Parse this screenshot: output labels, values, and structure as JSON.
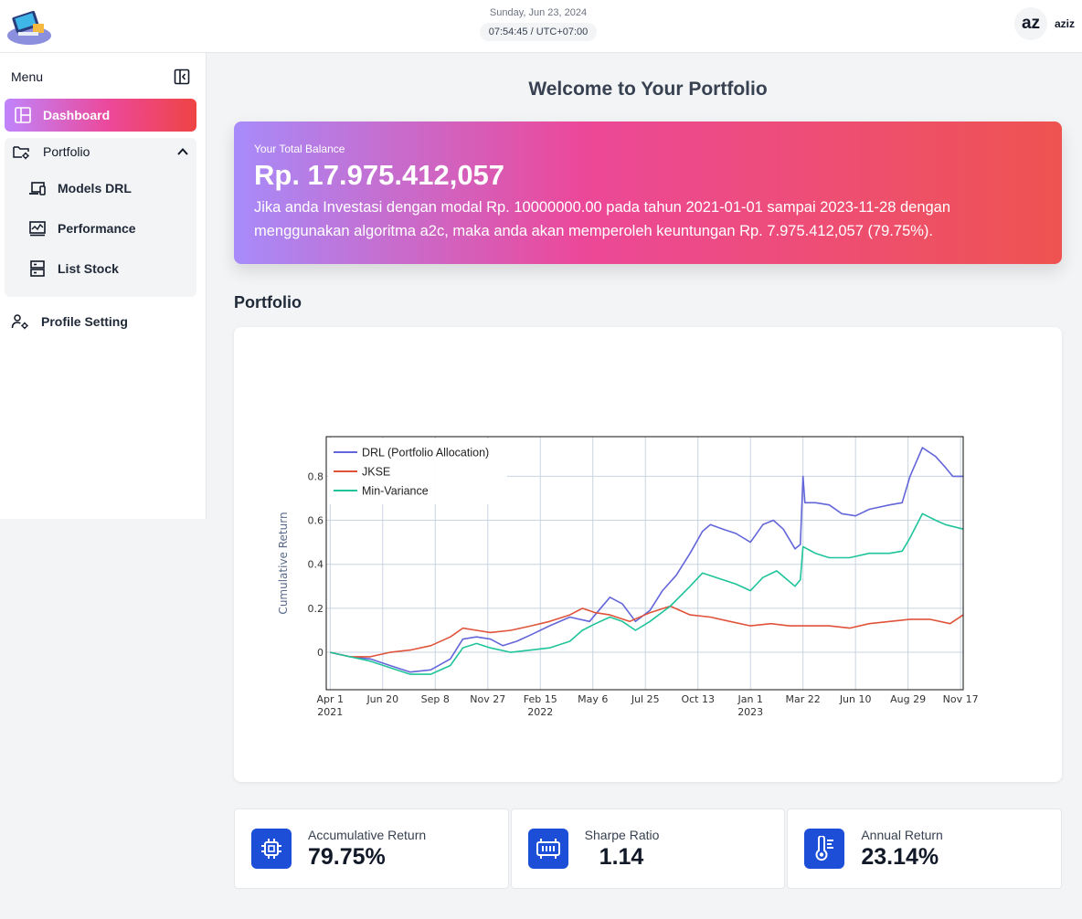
{
  "header": {
    "date": "Sunday, Jun 23, 2024",
    "time": "07:54:45 / UTC+07:00",
    "avatar_initials": "az",
    "username": "aziz"
  },
  "sidebar": {
    "menu_label": "Menu",
    "dashboard_label": "Dashboard",
    "portfolio_label": "Portfolio",
    "sub_items": [
      "Models DRL",
      "Performance",
      "List Stock"
    ],
    "profile_label": "Profile Setting"
  },
  "main": {
    "welcome": "Welcome to Your Portfolio",
    "balance_label": "Your Total Balance",
    "balance_amount": "Rp. 17.975.412,057",
    "balance_desc": "Jika anda Investasi dengan modal Rp. 10000000.00 pada tahun 2021-01-01 sampai 2023-11-28 dengan menggunakan algoritma a2c, maka anda akan memperoleh keuntungan Rp. 7.975.412,057 (79.75%).",
    "section_title": "Portfolio"
  },
  "stats": [
    {
      "name": "Accumulative Return",
      "value": "79.75%"
    },
    {
      "name": "Sharpe Ratio",
      "value": "1.14"
    },
    {
      "name": "Annual Return",
      "value": "23.14%"
    }
  ],
  "colors": {
    "drl": "#6366d9",
    "jkse": "#e0533a",
    "minvar": "#1fc49a",
    "accent_blue": "#1d4ed8"
  },
  "chart_data": {
    "type": "line",
    "ylabel": "Cumulative Return",
    "ylim": [
      -0.17,
      0.98
    ],
    "y_ticks": [
      "0",
      "0.2",
      "0.4",
      "0.6",
      "0.8"
    ],
    "x_ticks": [
      {
        "date": "2021-04-01",
        "label": "Apr 1",
        "sub": "2021"
      },
      {
        "date": "2021-06-20",
        "label": "Jun 20",
        "sub": ""
      },
      {
        "date": "2021-09-08",
        "label": "Sep 8",
        "sub": ""
      },
      {
        "date": "2021-11-27",
        "label": "Nov 27",
        "sub": ""
      },
      {
        "date": "2022-02-15",
        "label": "Feb 15",
        "sub": "2022"
      },
      {
        "date": "2022-05-06",
        "label": "May 6",
        "sub": ""
      },
      {
        "date": "2022-07-25",
        "label": "Jul 25",
        "sub": ""
      },
      {
        "date": "2022-10-13",
        "label": "Oct 13",
        "sub": ""
      },
      {
        "date": "2023-01-01",
        "label": "Jan 1",
        "sub": "2023"
      },
      {
        "date": "2023-03-22",
        "label": "Mar 22",
        "sub": ""
      },
      {
        "date": "2023-06-10",
        "label": "Jun 10",
        "sub": ""
      },
      {
        "date": "2023-08-29",
        "label": "Aug 29",
        "sub": ""
      },
      {
        "date": "2023-11-17",
        "label": "Nov 17",
        "sub": ""
      }
    ],
    "xlim": [
      "2021-03-26",
      "2023-11-21"
    ],
    "legend_position": "top-left",
    "series": [
      {
        "name": "DRL (Portfolio Allocation)",
        "color": "#6366d9",
        "points": [
          [
            "2021-04-01",
            0.0
          ],
          [
            "2021-05-01",
            -0.02
          ],
          [
            "2021-06-01",
            -0.03
          ],
          [
            "2021-07-01",
            -0.06
          ],
          [
            "2021-08-01",
            -0.09
          ],
          [
            "2021-09-01",
            -0.08
          ],
          [
            "2021-10-01",
            -0.03
          ],
          [
            "2021-10-20",
            0.06
          ],
          [
            "2021-11-10",
            0.07
          ],
          [
            "2021-12-01",
            0.06
          ],
          [
            "2021-12-20",
            0.03
          ],
          [
            "2022-01-10",
            0.05
          ],
          [
            "2022-02-01",
            0.08
          ],
          [
            "2022-03-01",
            0.12
          ],
          [
            "2022-04-01",
            0.16
          ],
          [
            "2022-05-01",
            0.14
          ],
          [
            "2022-06-01",
            0.25
          ],
          [
            "2022-06-20",
            0.22
          ],
          [
            "2022-07-10",
            0.14
          ],
          [
            "2022-08-01",
            0.19
          ],
          [
            "2022-08-20",
            0.28
          ],
          [
            "2022-09-10",
            0.35
          ],
          [
            "2022-10-01",
            0.45
          ],
          [
            "2022-10-20",
            0.55
          ],
          [
            "2022-11-01",
            0.58
          ],
          [
            "2022-11-20",
            0.56
          ],
          [
            "2022-12-10",
            0.54
          ],
          [
            "2023-01-01",
            0.5
          ],
          [
            "2023-01-20",
            0.58
          ],
          [
            "2023-02-05",
            0.6
          ],
          [
            "2023-02-20",
            0.56
          ],
          [
            "2023-03-10",
            0.47
          ],
          [
            "2023-03-18",
            0.49
          ],
          [
            "2023-03-22",
            0.8
          ],
          [
            "2023-03-25",
            0.68
          ],
          [
            "2023-04-10",
            0.68
          ],
          [
            "2023-05-01",
            0.67
          ],
          [
            "2023-05-20",
            0.63
          ],
          [
            "2023-06-10",
            0.62
          ],
          [
            "2023-07-01",
            0.65
          ],
          [
            "2023-08-01",
            0.67
          ],
          [
            "2023-08-20",
            0.68
          ],
          [
            "2023-09-01",
            0.8
          ],
          [
            "2023-09-20",
            0.93
          ],
          [
            "2023-10-10",
            0.89
          ],
          [
            "2023-10-25",
            0.84
          ],
          [
            "2023-11-05",
            0.8
          ],
          [
            "2023-11-21",
            0.8
          ]
        ]
      },
      {
        "name": "JKSE",
        "color": "#e0533a",
        "points": [
          [
            "2021-04-01",
            0.0
          ],
          [
            "2021-05-01",
            -0.02
          ],
          [
            "2021-06-01",
            -0.02
          ],
          [
            "2021-07-01",
            0.0
          ],
          [
            "2021-08-01",
            0.01
          ],
          [
            "2021-09-01",
            0.03
          ],
          [
            "2021-10-01",
            0.07
          ],
          [
            "2021-10-20",
            0.11
          ],
          [
            "2021-11-10",
            0.1
          ],
          [
            "2021-12-01",
            0.09
          ],
          [
            "2022-01-01",
            0.1
          ],
          [
            "2022-02-01",
            0.12
          ],
          [
            "2022-03-01",
            0.14
          ],
          [
            "2022-04-01",
            0.17
          ],
          [
            "2022-04-20",
            0.2
          ],
          [
            "2022-05-10",
            0.18
          ],
          [
            "2022-06-01",
            0.17
          ],
          [
            "2022-07-01",
            0.14
          ],
          [
            "2022-08-01",
            0.18
          ],
          [
            "2022-09-01",
            0.21
          ],
          [
            "2022-10-01",
            0.17
          ],
          [
            "2022-11-01",
            0.16
          ],
          [
            "2022-12-01",
            0.14
          ],
          [
            "2023-01-01",
            0.12
          ],
          [
            "2023-02-01",
            0.13
          ],
          [
            "2023-03-01",
            0.12
          ],
          [
            "2023-04-01",
            0.12
          ],
          [
            "2023-05-01",
            0.12
          ],
          [
            "2023-06-01",
            0.11
          ],
          [
            "2023-07-01",
            0.13
          ],
          [
            "2023-08-01",
            0.14
          ],
          [
            "2023-09-01",
            0.15
          ],
          [
            "2023-10-01",
            0.15
          ],
          [
            "2023-11-01",
            0.13
          ],
          [
            "2023-11-21",
            0.17
          ]
        ]
      },
      {
        "name": "Min-Variance",
        "color": "#1fc49a",
        "points": [
          [
            "2021-04-01",
            0.0
          ],
          [
            "2021-05-01",
            -0.02
          ],
          [
            "2021-06-01",
            -0.04
          ],
          [
            "2021-07-01",
            -0.07
          ],
          [
            "2021-08-01",
            -0.1
          ],
          [
            "2021-09-01",
            -0.1
          ],
          [
            "2021-10-01",
            -0.06
          ],
          [
            "2021-10-20",
            0.02
          ],
          [
            "2021-11-10",
            0.04
          ],
          [
            "2021-12-01",
            0.02
          ],
          [
            "2022-01-01",
            0.0
          ],
          [
            "2022-02-01",
            0.01
          ],
          [
            "2022-03-01",
            0.02
          ],
          [
            "2022-04-01",
            0.05
          ],
          [
            "2022-04-20",
            0.1
          ],
          [
            "2022-05-10",
            0.13
          ],
          [
            "2022-06-01",
            0.16
          ],
          [
            "2022-06-20",
            0.14
          ],
          [
            "2022-07-10",
            0.1
          ],
          [
            "2022-08-01",
            0.14
          ],
          [
            "2022-09-01",
            0.21
          ],
          [
            "2022-10-01",
            0.3
          ],
          [
            "2022-10-20",
            0.36
          ],
          [
            "2022-11-20",
            0.33
          ],
          [
            "2022-12-10",
            0.31
          ],
          [
            "2023-01-01",
            0.28
          ],
          [
            "2023-01-20",
            0.34
          ],
          [
            "2023-02-10",
            0.37
          ],
          [
            "2023-03-10",
            0.3
          ],
          [
            "2023-03-18",
            0.33
          ],
          [
            "2023-03-22",
            0.48
          ],
          [
            "2023-04-10",
            0.45
          ],
          [
            "2023-05-01",
            0.43
          ],
          [
            "2023-06-01",
            0.43
          ],
          [
            "2023-07-01",
            0.45
          ],
          [
            "2023-08-01",
            0.45
          ],
          [
            "2023-08-20",
            0.46
          ],
          [
            "2023-09-01",
            0.52
          ],
          [
            "2023-09-20",
            0.63
          ],
          [
            "2023-10-10",
            0.6
          ],
          [
            "2023-10-25",
            0.58
          ],
          [
            "2023-11-21",
            0.56
          ]
        ]
      }
    ]
  }
}
